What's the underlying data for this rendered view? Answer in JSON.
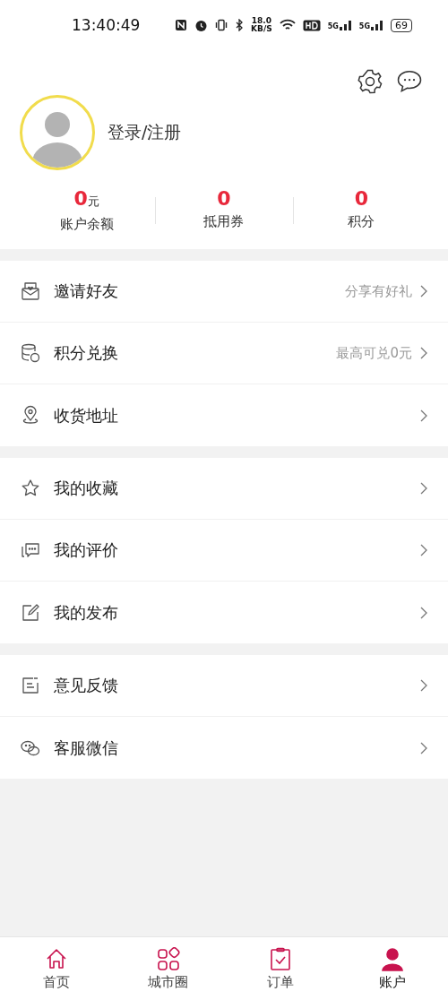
{
  "status_bar": {
    "time": "13:40:49",
    "speed": "18.0",
    "speed_unit": "KB/S",
    "network": [
      "5G",
      "5G"
    ],
    "battery": "69"
  },
  "profile": {
    "login": "登录/注册"
  },
  "stats": [
    {
      "value": "0",
      "unit": "元",
      "label": "账户余额"
    },
    {
      "value": "0",
      "label": "抵用券"
    },
    {
      "value": "0",
      "label": "积分"
    }
  ],
  "menu_groups": [
    [
      {
        "label": "邀请好友",
        "hint": "分享有好礼"
      },
      {
        "label": "积分兑换",
        "hint": "最高可兑0元"
      },
      {
        "label": "收货地址"
      }
    ],
    [
      {
        "label": "我的收藏"
      },
      {
        "label": "我的评价"
      },
      {
        "label": "我的发布"
      }
    ],
    [
      {
        "label": "意见反馈"
      },
      {
        "label": "客服微信"
      }
    ]
  ],
  "tab_bar": [
    {
      "label": "首页",
      "selected": false
    },
    {
      "label": "城市圈",
      "selected": false
    },
    {
      "label": "订单",
      "selected": false
    },
    {
      "label": "账户",
      "selected": true
    }
  ]
}
